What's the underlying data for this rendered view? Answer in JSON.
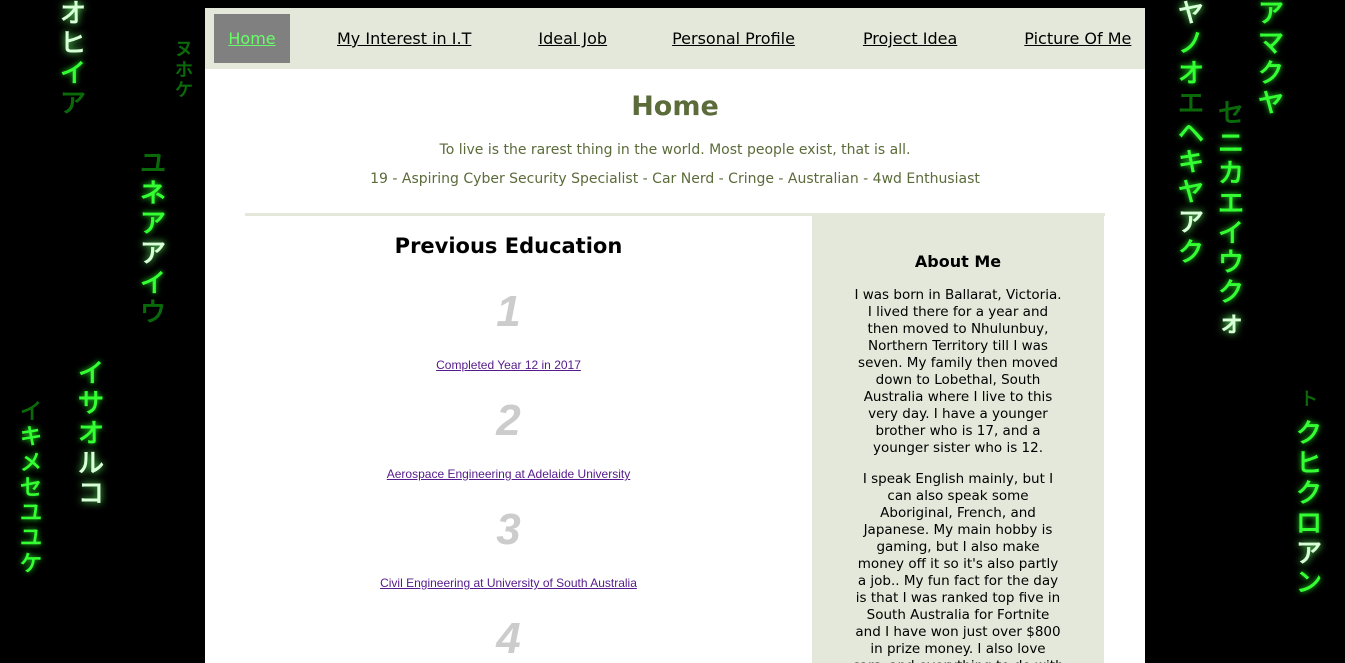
{
  "nav": {
    "items": [
      {
        "label": "Home",
        "active": true
      },
      {
        "label": "My Interest in I.T",
        "active": false
      },
      {
        "label": "Ideal Job",
        "active": false
      },
      {
        "label": "Personal Profile",
        "active": false
      },
      {
        "label": "Project Idea",
        "active": false
      },
      {
        "label": "Picture Of Me",
        "active": false
      }
    ]
  },
  "header": {
    "title": "Home",
    "quote": "To live is the rarest thing in the world. Most people exist, that is all.",
    "bio_line": "19 - Aspiring Cyber Security Specialist - Car Nerd - Cringe - Australian - 4wd Enthusiast"
  },
  "education": {
    "title": "Previous Education",
    "items": [
      {
        "number": "1",
        "label": "Completed Year 12 in 2017"
      },
      {
        "number": "2",
        "label": "Aerospace Engineering at Adelaide University"
      },
      {
        "number": "3",
        "label": "Civil Engineering at University of South Australia"
      },
      {
        "number": "4",
        "label": ""
      }
    ]
  },
  "about": {
    "title": "About Me",
    "paragraph1": "I was born in Ballarat, Victoria. I lived there for a year and then moved to Nhulunbuy, Northern Territory till I was seven. My family then moved down to Lobethal, South Australia where I live to this very day. I have a younger brother who is 17, and a younger sister who is 12.",
    "paragraph2": "I speak English mainly, but I can also speak some Aboriginal, French, and Japanese. My main hobby is gaming, but I also make money off it so it's also partly a job.. My fun fact for the day is that I was ranked top five in South Australia for Fortnite and I have won just over $800 in prize money. I also love cars, and everything to do with them."
  },
  "colors": {
    "nav_bg": "#e4e8da",
    "nav_active_bg": "#808080",
    "nav_active_text": "#66ff66",
    "title_green": "#5b6b3a",
    "about_bg": "#e4e8da",
    "matrix_green": "#33ff33"
  },
  "background": {
    "style": "matrix-code-rain"
  }
}
